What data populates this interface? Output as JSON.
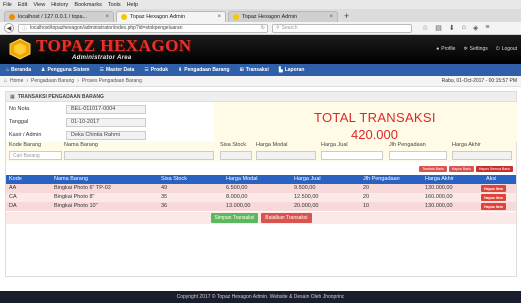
{
  "browser": {
    "menu": [
      "File",
      "Edit",
      "View",
      "History",
      "Bookmarks",
      "Tools",
      "Help"
    ],
    "tabs": [
      {
        "label": "localhost / 127.0.0.1 / topa...",
        "active": false
      },
      {
        "label": "Topaz Hexagon Admin",
        "active": true
      },
      {
        "label": "Topaz Hexagon Admin",
        "active": false
      }
    ],
    "url": "localhost/topazhexagon/administrator/index.php?id=stokpengeluaran",
    "search_placeholder": "Search"
  },
  "header": {
    "logo_title": "TOPAZ HEXAGON",
    "logo_subtitle": "Administrator Area",
    "user_links": [
      "Profile",
      "Settings",
      "Logout"
    ]
  },
  "menu": {
    "items": [
      "Beranda",
      "Pengguna Sistem",
      "Master Data",
      "Produk",
      "Pengadaan Barang",
      "Transaksi",
      "Laporan"
    ]
  },
  "breadcrumb": {
    "items": [
      "Home",
      "Pengadaan Barang",
      "Proses Pengadaan Barang"
    ],
    "datetime": "Rabu, 01-Oct-2017 - 00:15:57 PM"
  },
  "panel": {
    "title": "TRANSAKSI PENGADAAN BARANG",
    "fields": [
      {
        "label": "No Nota",
        "value": "BEL-011017-0004"
      },
      {
        "label": "Tanggal",
        "value": "01-10-2017"
      },
      {
        "label": "Kasir / Admin",
        "value": "Deka Chintia Rahmi"
      }
    ],
    "total_label": "TOTAL TRANSAKSI",
    "total_value": "420.000",
    "entry_headers": [
      "Kode Barang",
      "Nama Barang",
      "Sisa Stock",
      "Harga Modal",
      "Harga Jual",
      "Jlh Pengadaan",
      "Harga Akhir"
    ],
    "entry_placeholder": "Cari Barang",
    "small_buttons": [
      "Tambah Baris",
      "Hapus Baris",
      "Hapus Semua Baris"
    ],
    "table_headers": [
      "Kode",
      "Nama Barang",
      "Sisa Stock",
      "Harga Modal",
      "Harga Jual",
      "Jlh Pengadaan",
      "Harga Akhir",
      "Aksi"
    ],
    "rows": [
      {
        "kode": "AA",
        "nama": "Bingkai Photo 6\" TP-02",
        "stock": "49",
        "modal": "6.500,00",
        "jual": "9.500,00",
        "jumlah": "20",
        "akhir": "130.000,00",
        "aksi": "Hapus Item"
      },
      {
        "kode": "CA",
        "nama": "Bingkai Photo 8\"",
        "stock": "35",
        "modal": "8.000,00",
        "jual": "12.500,00",
        "jumlah": "20",
        "akhir": "160.000,00",
        "aksi": "Hapus Item"
      },
      {
        "kode": "DA",
        "nama": "Bingkai Photo 10\"",
        "stock": "36",
        "modal": "13.000,00",
        "jual": "20.000,00",
        "jumlah": "10",
        "akhir": "130.000,00",
        "aksi": "Hapus Item"
      }
    ],
    "save_label": "Simpan Transaksi",
    "cancel_label": "Batalkan Transaksi"
  },
  "footer": {
    "text": "Copyright 2017 © Topaz Hexagon Admin. Website & Desain Oleh Jhonprinc"
  },
  "colors": {
    "brand_red": "#e6332a",
    "menu_blue": "#2e5fa8",
    "table_header": "#2962c0",
    "total_red": "#d92a2a",
    "footer_bg": "#1a1d2b"
  }
}
